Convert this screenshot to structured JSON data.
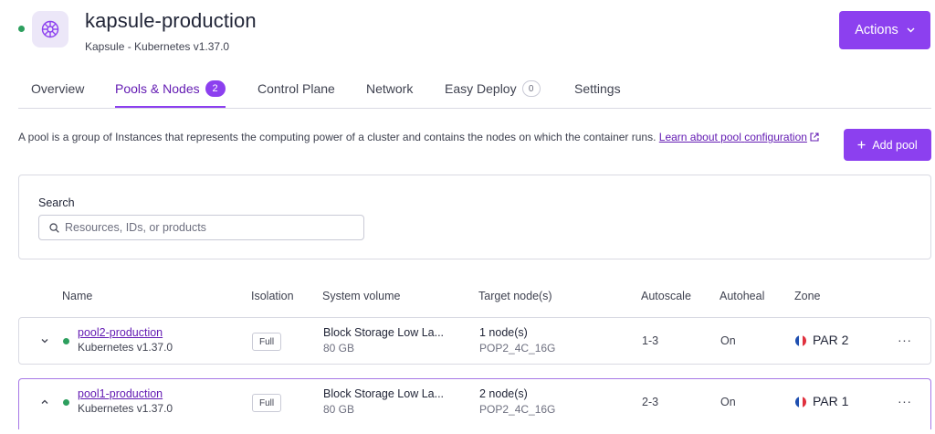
{
  "header": {
    "title": "kapsule-production",
    "subtitle": "Kapsule - Kubernetes v1.37.0",
    "actions_label": "Actions",
    "status_color": "#2d9f5e",
    "logo_icon": "kubernetes-helm-icon"
  },
  "tabs": [
    {
      "label": "Overview",
      "active": false
    },
    {
      "label": "Pools & Nodes",
      "active": true,
      "badge": "2"
    },
    {
      "label": "Control Plane",
      "active": false
    },
    {
      "label": "Network",
      "active": false
    },
    {
      "label": "Easy Deploy",
      "active": false,
      "badge": "0"
    },
    {
      "label": "Settings",
      "active": false
    }
  ],
  "description": {
    "text": "A pool is a group of Instances that represents the computing power of a cluster and contains the nodes on which the container runs.",
    "link_part1": "Learn about pool",
    "link_part2": "configuration"
  },
  "add_pool_label": "Add pool",
  "search": {
    "label": "Search",
    "placeholder": "Resources, IDs, or products"
  },
  "table": {
    "headers": {
      "name": "Name",
      "isolation": "Isolation",
      "system_volume": "System volume",
      "target_nodes": "Target node(s)",
      "autoscale": "Autoscale",
      "autoheal": "Autoheal",
      "zone": "Zone"
    },
    "rows": [
      {
        "name": "pool2-production",
        "version": "Kubernetes v1.37.0",
        "isolation": "Full",
        "volume": "Block Storage Low La...",
        "volume_size": "80 GB",
        "nodes": "1 node(s)",
        "node_type": "POP2_4C_16G",
        "autoscale": "1-3",
        "autoheal": "On",
        "zone": "PAR 2",
        "expanded": false
      },
      {
        "name": "pool1-production",
        "version": "Kubernetes v1.37.0",
        "isolation": "Full",
        "volume": "Block Storage Low La...",
        "volume_size": "80 GB",
        "nodes": "2 node(s)",
        "node_type": "POP2_4C_16G",
        "autoscale": "2-3",
        "autoheal": "On",
        "zone": "PAR 1",
        "expanded": true
      }
    ],
    "more_label": "···"
  },
  "colors": {
    "accent": "#8c40ef",
    "accent_text": "#641cb3",
    "status_ok": "#2d9f5e"
  }
}
